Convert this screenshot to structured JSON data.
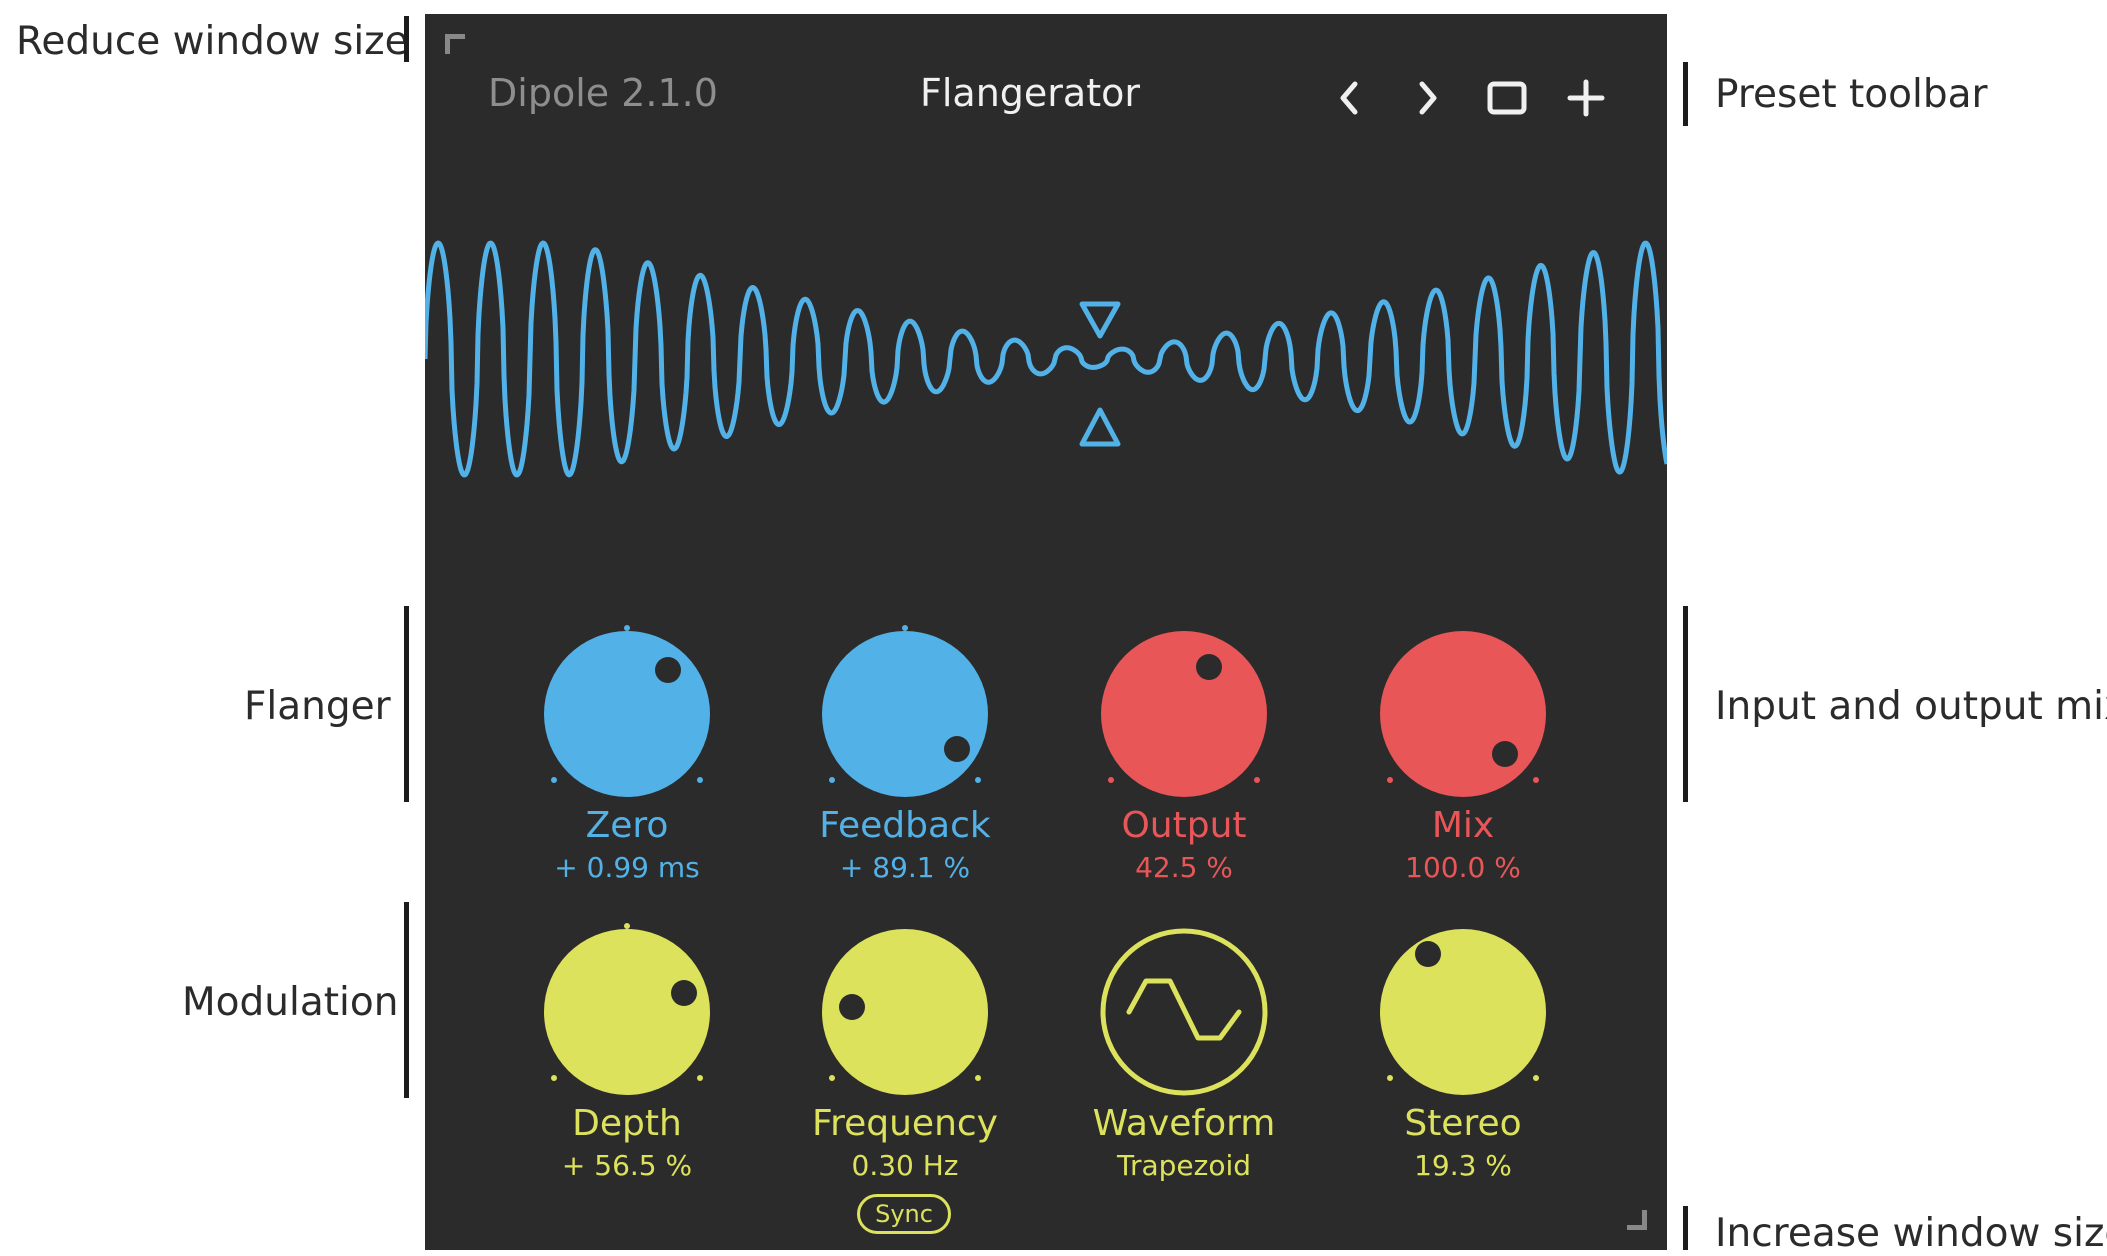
{
  "annotations": {
    "reduce_window_size": "Reduce window size",
    "preset_toolbar": "Preset toolbar",
    "flanger": "Flanger",
    "input_output_mix": "Input and output mix",
    "modulation": "Modulation",
    "increase_window_size": "Increase window size"
  },
  "header": {
    "version": "Dipole 2.1.0",
    "preset_name": "Flangerator",
    "icons": [
      "chevron-left-icon",
      "chevron-right-icon",
      "window-icon",
      "plus-icon"
    ]
  },
  "colors": {
    "background": "#2b2b2b",
    "blue": "#52b2e8",
    "red": "#e85658",
    "yellow": "#dde25c",
    "text_dim": "#8e8e8e",
    "text_bright": "#f0f0f0"
  },
  "flanger": {
    "zero": {
      "label": "Zero",
      "value": "+ 0.99 ms"
    },
    "feedback": {
      "label": "Feedback",
      "value": "+ 89.1 %"
    }
  },
  "mix": {
    "output": {
      "label": "Output",
      "value": "42.5 %"
    },
    "mix": {
      "label": "Mix",
      "value": "100.0 %"
    }
  },
  "modulation": {
    "depth": {
      "label": "Depth",
      "value": "+ 56.5 %"
    },
    "frequency": {
      "label": "Frequency",
      "value": "0.30 Hz",
      "sync_label": "Sync"
    },
    "waveform": {
      "label": "Waveform",
      "value": "Trapezoid"
    },
    "stereo": {
      "label": "Stereo",
      "value": "19.3 %"
    }
  }
}
